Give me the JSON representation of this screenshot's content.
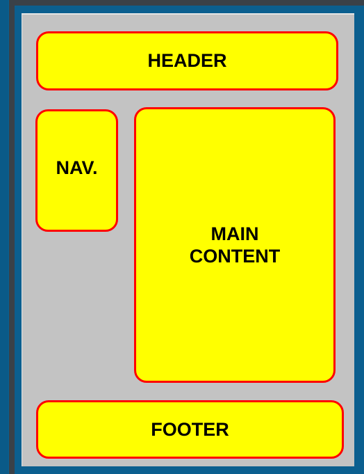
{
  "diagram": {
    "header": {
      "label": "HEADER"
    },
    "nav": {
      "label": "NAV."
    },
    "main": {
      "label": "MAIN\nCONTENT"
    },
    "footer": {
      "label": "FOOTER"
    }
  },
  "colors": {
    "outer_background": "#0b5f8f",
    "frame_dark": "#3a4148",
    "canvas": "#c3c3c3",
    "block_fill": "#ffff00",
    "block_border": "#ff0000",
    "text": "#000000"
  }
}
